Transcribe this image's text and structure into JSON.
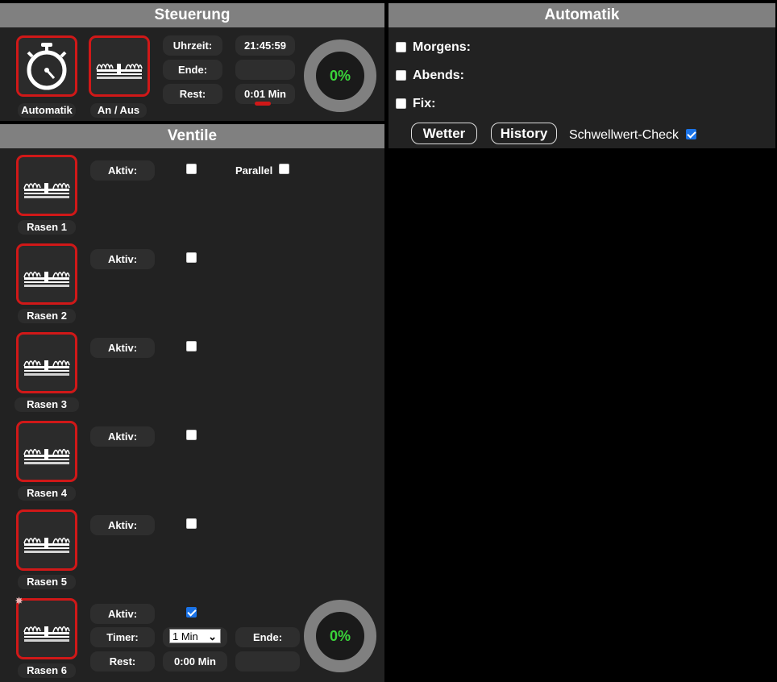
{
  "steuerung": {
    "title": "Steuerung",
    "automatik_label": "Automatik",
    "anaus_label": "An / Aus",
    "uhrzeit_label": "Uhrzeit:",
    "uhrzeit_value": "21:45:59",
    "ende_label": "Ende:",
    "ende_value": "",
    "rest_label": "Rest:",
    "rest_value": "0:01 Min",
    "progress": "0%"
  },
  "ventile": {
    "title": "Ventile",
    "aktiv_label": "Aktiv:",
    "parallel_label": "Parallel",
    "parallel_checked": false,
    "items": [
      {
        "name": "Rasen 1",
        "aktiv": false
      },
      {
        "name": "Rasen 2",
        "aktiv": false
      },
      {
        "name": "Rasen 3",
        "aktiv": false
      },
      {
        "name": "Rasen 4",
        "aktiv": false
      },
      {
        "name": "Rasen 5",
        "aktiv": false
      },
      {
        "name": "Rasen 6",
        "aktiv": true
      }
    ],
    "detail": {
      "timer_label": "Timer:",
      "timer_value": "1 Min",
      "rest_label": "Rest:",
      "rest_value": "0:00 Min",
      "ende_label": "Ende:",
      "ende_value": "",
      "progress": "0%"
    }
  },
  "automatik": {
    "title": "Automatik",
    "morgens": "Morgens:",
    "abends": "Abends:",
    "fix": "Fix:",
    "wetter": "Wetter",
    "history": "History",
    "schwellwert": "Schwellwert-Check",
    "schwellwert_checked": true
  },
  "colors": {
    "accent_border": "#d01818",
    "progress_text": "#3ad43a",
    "header": "#808080"
  }
}
